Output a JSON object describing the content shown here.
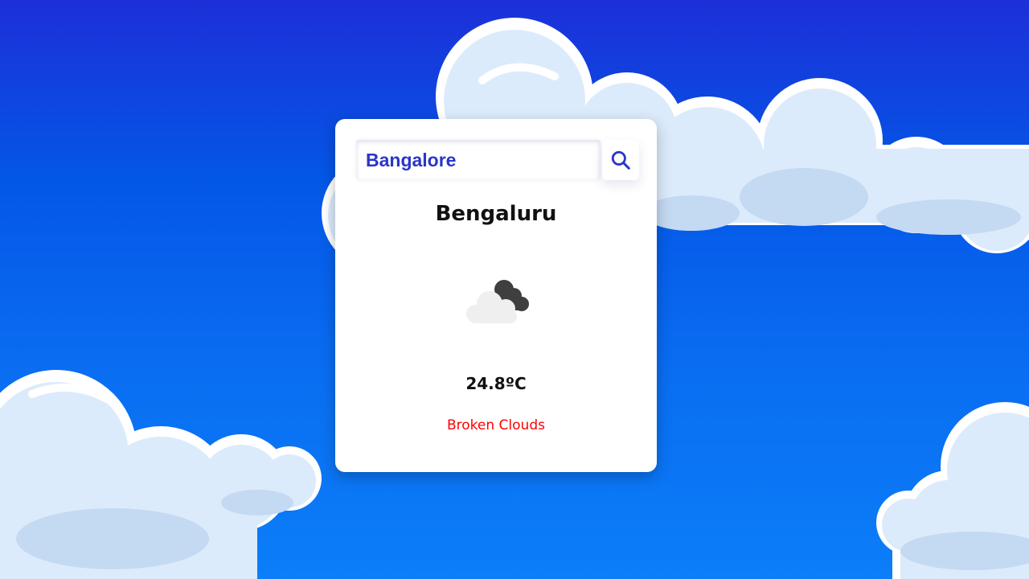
{
  "search": {
    "value": "Bangalore",
    "icon": "search-icon"
  },
  "weather": {
    "city": "Bengaluru",
    "icon": "broken-clouds-icon",
    "temperature": "24.8ºC",
    "description": "Broken Clouds"
  },
  "colors": {
    "background_top": "#1d2fd8",
    "background_bottom": "#0b7ef8",
    "accent": "#2a35c9",
    "description": "#ff0000"
  }
}
